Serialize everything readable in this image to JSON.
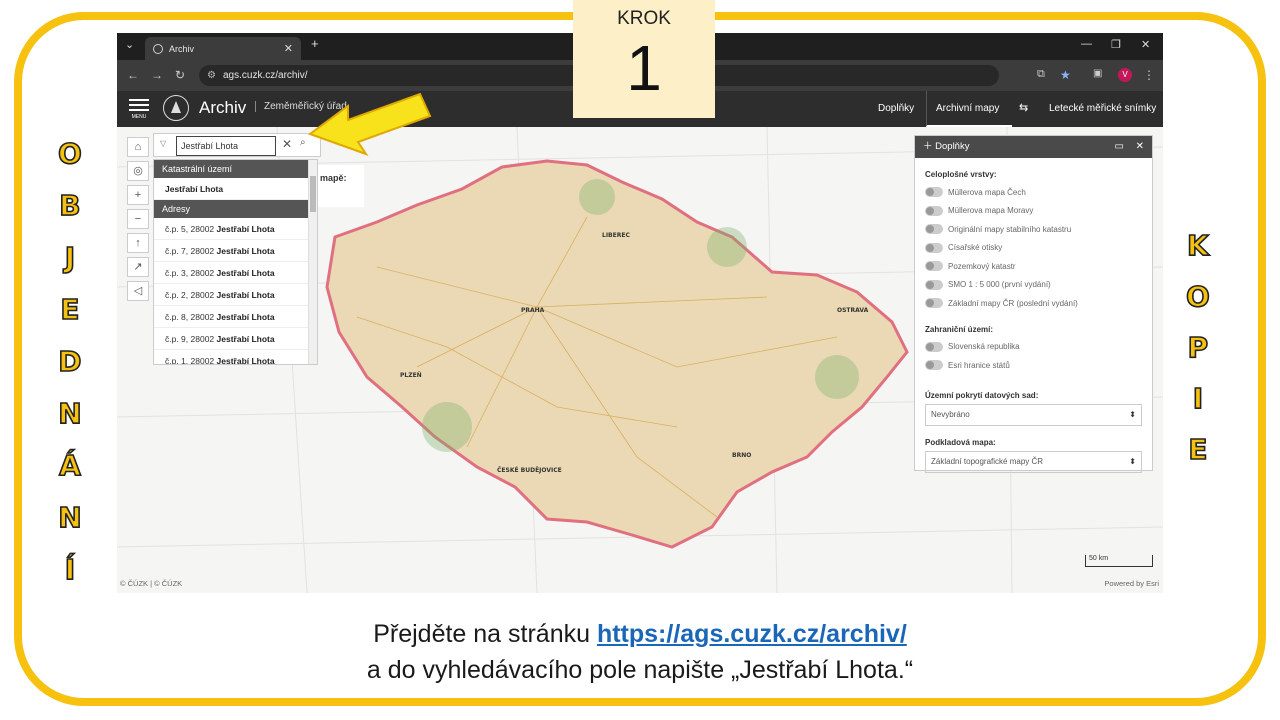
{
  "step": {
    "label": "KROK",
    "number": "1"
  },
  "left_side_letters": [
    "O",
    "B",
    "J",
    "E",
    "D",
    "N",
    "Á",
    "N",
    "Í"
  ],
  "right_side_letters": [
    "K",
    "O",
    "P",
    "I",
    "E"
  ],
  "browser": {
    "tab_title": "Archiv",
    "url": "ags.cuzk.cz/archiv/",
    "profile_initial": "V"
  },
  "app": {
    "menu_label": "MENU",
    "title": "Archiv",
    "org": "Zeměměřický úřad",
    "nav": {
      "addons": "Doplňky",
      "archive_maps": "Archivní mapy",
      "aerial": "Letecké měřické snímky"
    }
  },
  "search": {
    "value": "Jestřabí Lhota",
    "groups": [
      {
        "heading": "Katastrální území",
        "items": [
          {
            "prefix": "",
            "name": "Jestřabí Lhota"
          }
        ]
      },
      {
        "heading": "Adresy",
        "items": [
          {
            "prefix": "č.p. 5, 28002 ",
            "name": "Jestřabí Lhota"
          },
          {
            "prefix": "č.p. 7, 28002 ",
            "name": "Jestřabí Lhota"
          },
          {
            "prefix": "č.p. 3, 28002 ",
            "name": "Jestřabí Lhota"
          },
          {
            "prefix": "č.p. 2, 28002 ",
            "name": "Jestřabí Lhota"
          },
          {
            "prefix": "č.p. 8, 28002 ",
            "name": "Jestřabí Lhota"
          },
          {
            "prefix": "č.p. 9, 28002 ",
            "name": "Jestřabí Lhota"
          },
          {
            "prefix": "č.p. 1, 28002 ",
            "name": "Jestřabí Lhota"
          }
        ]
      }
    ]
  },
  "peek_text": "mapě:",
  "panel": {
    "title": "Doplňky",
    "section1": "Celoplošné vrstvy:",
    "layers": [
      "Müllerova mapa Čech",
      "Müllerova mapa Moravy",
      "Originální mapy stabilního katastru",
      "Císařské otisky",
      "Pozemkový katastr",
      "SMO 1 : 5 000 (první vydání)",
      "Základní mapy ČR (poslední vydání)"
    ],
    "section2": "Zahraniční území:",
    "foreign": [
      "Slovenská republika",
      "Esri hranice států"
    ],
    "section3": "Územní pokrytí datových sad:",
    "coverage_value": "Nevybráno",
    "section4": "Podkladová mapa:",
    "basemap_value": "Základní topografické mapy ČR"
  },
  "map": {
    "scale": "50 km",
    "attribution": "© ČÚZK | © ČÚZK",
    "powered": "Powered by Esri",
    "labels": [
      "PRAHA",
      "PLZEŇ",
      "BRNO",
      "LIBEREC",
      "ČESKÉ BUDĚJOVICE",
      "OSTRAVA"
    ]
  },
  "caption": {
    "line1_prefix": "Přejděte na stránku ",
    "line1_link": "https://ags.cuzk.cz/archiv/",
    "line2": "a do vyhledávacího pole napište „Jestřabí Lhota.“"
  },
  "colors": {
    "frame": "#f6c10f",
    "arrow": "#f7e21c",
    "link": "#1a66b8",
    "header": "#2d2d2d"
  }
}
